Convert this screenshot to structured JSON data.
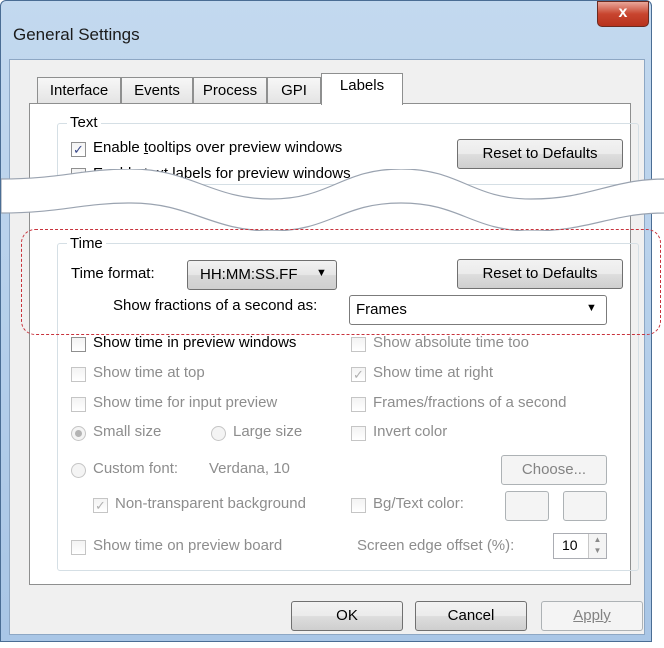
{
  "window": {
    "title": "General Settings",
    "close_glyph": "x"
  },
  "tabs": [
    "Interface",
    "Events",
    "Process",
    "GPI",
    "Labels"
  ],
  "active_tab": "Labels",
  "text_group": {
    "label": "Text",
    "tooltips_label": "Enable tooltips over preview windows",
    "tooltips_accel": "t",
    "tooltips_checked": true,
    "text_labels_label": "Enable text labels for preview windows",
    "text_labels_checked": true,
    "reset_label": "Reset to Defaults"
  },
  "time_group": {
    "label": "Time",
    "format_label": "Time format:",
    "format_value": "HH:MM:SS.FF",
    "reset_label": "Reset to Defaults",
    "fractions_label": "Show fractions of a second as:",
    "fractions_value": "Frames"
  },
  "options": {
    "show_time_preview": "Show time in preview windows",
    "show_absolute": "Show absolute time too",
    "show_time_top": "Show time at top",
    "show_time_right": "Show time at right",
    "show_time_right_checked": true,
    "show_time_input": "Show time for input preview",
    "frames_fractions": "Frames/fractions of a second",
    "small_size": "Small size",
    "large_size": "Large size",
    "invert_color": "Invert color",
    "custom_font": "Custom font:",
    "custom_font_value": "Verdana, 10",
    "choose": "Choose...",
    "non_transparent": "Non-transparent background",
    "non_transparent_checked": true,
    "bg_text_color": "Bg/Text color:",
    "show_time_board": "Show time on preview board",
    "edge_offset_label": "Screen edge offset (%):",
    "edge_offset_value": "10"
  },
  "footer": {
    "ok": "OK",
    "cancel": "Cancel",
    "apply": "Apply"
  },
  "colors": {
    "highlight_dash": "#c8323c",
    "close_button": "#c8452f"
  }
}
